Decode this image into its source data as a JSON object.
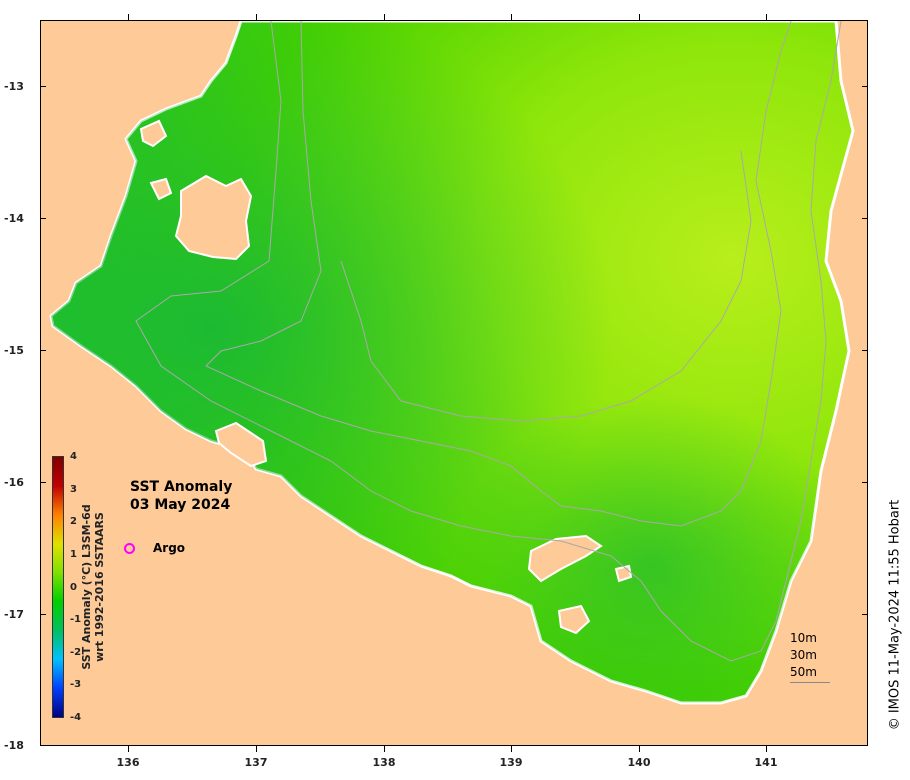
{
  "map": {
    "title_line1": "SST Anomaly",
    "title_line2": "03 May 2024",
    "argo_label": "Argo",
    "credit": "© IMOS 11-May-2024 11:55 Hobart",
    "lat_ticks": [
      {
        "label": "-13",
        "value": -13
      },
      {
        "label": "-14",
        "value": -14
      },
      {
        "label": "-15",
        "value": -15
      },
      {
        "label": "-16",
        "value": -16
      },
      {
        "label": "-17",
        "value": -17
      },
      {
        "label": "-18",
        "value": -18
      }
    ],
    "lon_ticks": [
      {
        "label": "136",
        "value": 136
      },
      {
        "label": "137",
        "value": 137
      },
      {
        "label": "138",
        "value": 138
      },
      {
        "label": "139",
        "value": 139
      },
      {
        "label": "140",
        "value": 140
      },
      {
        "label": "141",
        "value": 141
      }
    ],
    "extent": {
      "lon_min": 135.07,
      "lon_max": 141.75,
      "lat_max": -12.5,
      "lat_min": -18.0
    },
    "colors": {
      "land": "#fdca98",
      "argo_marker": "#ff00ff",
      "contour": "#a9a9a9"
    }
  },
  "colorbar": {
    "label_line1": "SST Anomaly (°C) L3SM-6d",
    "label_line2": "wrt 1992-2016 SSTAARS",
    "min": -4,
    "max": 4,
    "ticks": [
      "4",
      "3",
      "2",
      "1",
      "0",
      "-1",
      "-2",
      "-3",
      "-4"
    ],
    "colors": [
      "#00007f",
      "#0040ff",
      "#00c0ff",
      "#00c060",
      "#00d000",
      "#80e000",
      "#e0e000",
      "#ff8000",
      "#c00000",
      "#7f0000"
    ]
  },
  "contour_legend": {
    "items": [
      "10m",
      "30m",
      "50m"
    ]
  }
}
